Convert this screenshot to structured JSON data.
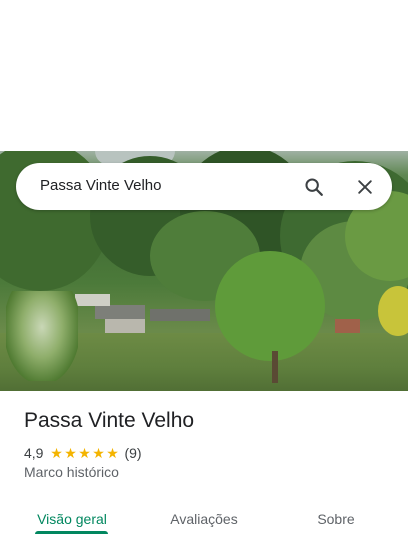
{
  "search": {
    "query": "Passa Vinte Velho",
    "search_icon": "search-icon",
    "close_icon": "close-icon"
  },
  "place": {
    "name": "Passa Vinte Velho",
    "rating": "4,9",
    "rating_value": 4.9,
    "stars_max": 5,
    "review_count": "(9)",
    "category": "Marco histórico",
    "photo": "landscape-photo"
  },
  "tabs": [
    {
      "label": "Visão geral",
      "active": true
    },
    {
      "label": "Avaliações",
      "active": false
    },
    {
      "label": "Sobre",
      "active": false
    }
  ],
  "colors": {
    "accent": "#01875f",
    "star": "#f4b400",
    "text_primary": "#202124",
    "text_secondary": "#5f6368"
  }
}
